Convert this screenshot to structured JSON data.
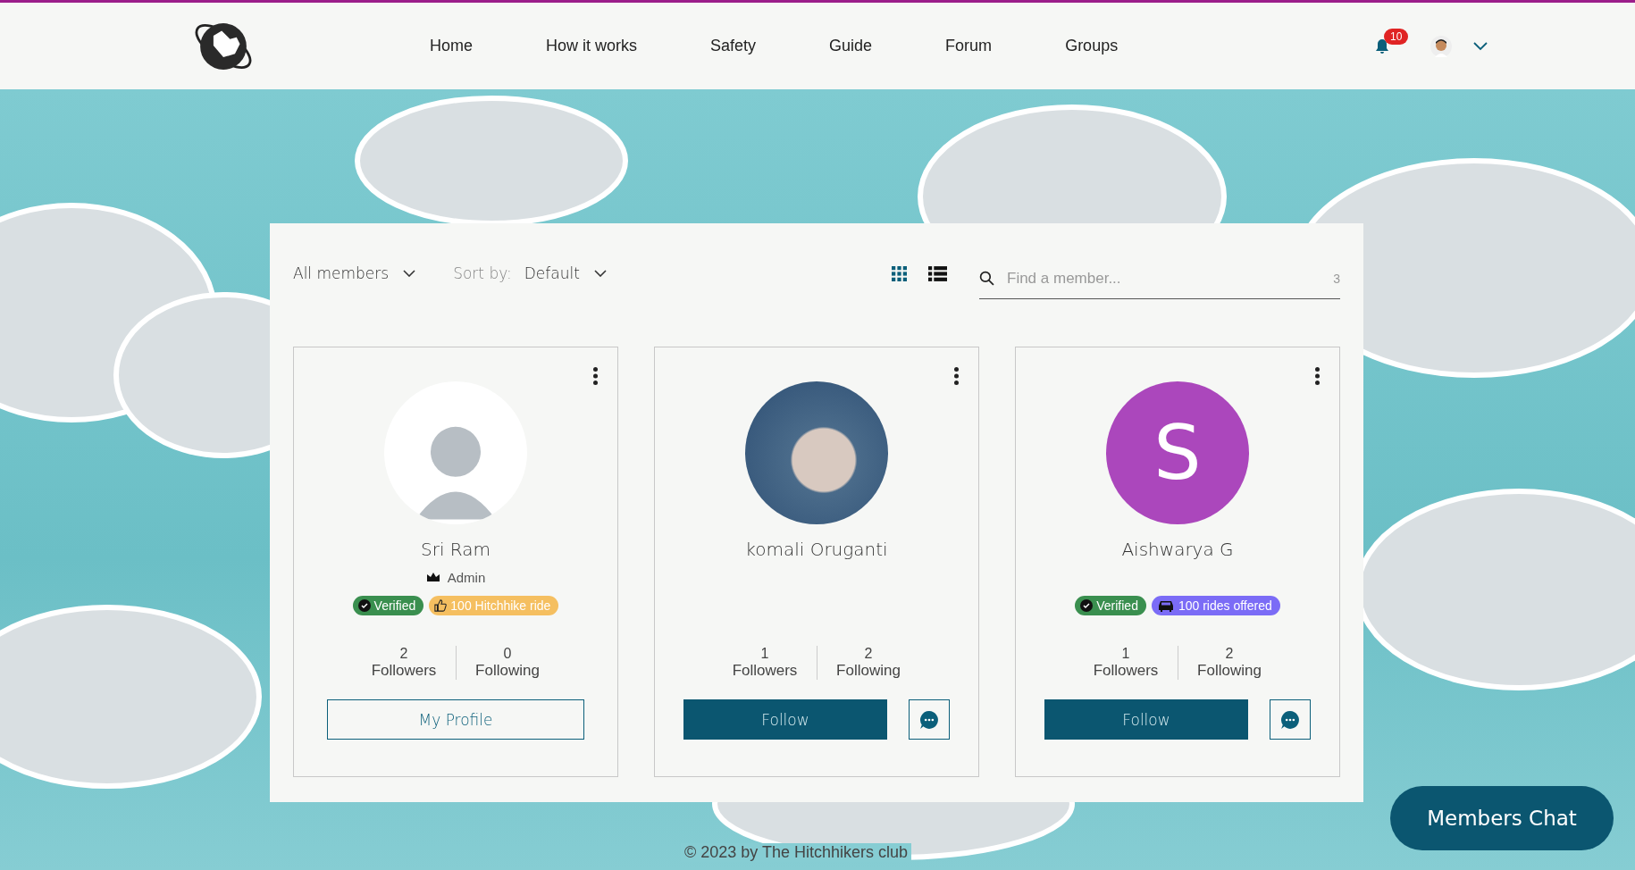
{
  "header": {
    "nav": [
      {
        "label": "Home"
      },
      {
        "label": "How it works"
      },
      {
        "label": "Safety"
      },
      {
        "label": "Guide"
      },
      {
        "label": "Forum"
      },
      {
        "label": "Groups"
      }
    ],
    "notifications": {
      "count": "10"
    }
  },
  "toolbar": {
    "filter": "All members",
    "sort_label": "Sort by:",
    "sort_value": "Default",
    "views": [
      {
        "kind": "grid",
        "selected": true
      },
      {
        "kind": "list",
        "selected": false
      }
    ],
    "search": {
      "placeholder": "Find a member...",
      "count": "3"
    }
  },
  "members": [
    {
      "name": "Sri Ram",
      "avatar": {
        "kind": "cartoon"
      },
      "role": "Admin",
      "badges": [
        {
          "kind": "check",
          "label": "Verified",
          "color": "#3a8f4f"
        },
        {
          "kind": "thumbs-up",
          "label": "100 Hitchhike ride",
          "color": "#f5bf60"
        }
      ],
      "followers": "2",
      "followers_label": "Followers",
      "following": "0",
      "following_label": "Following",
      "action": {
        "kind": "outline",
        "label": "My Profile"
      }
    },
    {
      "name": "komali Oruganti",
      "avatar": {
        "kind": "photo"
      },
      "followers": "1",
      "followers_label": "Followers",
      "following": "2",
      "following_label": "Following",
      "action": {
        "kind": "filled",
        "label": "Follow",
        "chat": true
      }
    },
    {
      "name": "Aishwarya G",
      "avatar": {
        "kind": "letter",
        "letter": "S",
        "color": "#ab47bc"
      },
      "badges": [
        {
          "kind": "check",
          "label": "Verified",
          "color": "#3a8f4f"
        },
        {
          "kind": "car",
          "label": "100 rides offered",
          "color": "#7b6cf6"
        }
      ],
      "followers": "1",
      "followers_label": "Followers",
      "following": "2",
      "following_label": "Following",
      "action": {
        "kind": "filled",
        "label": "Follow",
        "chat": true
      }
    }
  ],
  "chat_button": "Members Chat",
  "footer": "© 2023 by The Hitchhikers club"
}
